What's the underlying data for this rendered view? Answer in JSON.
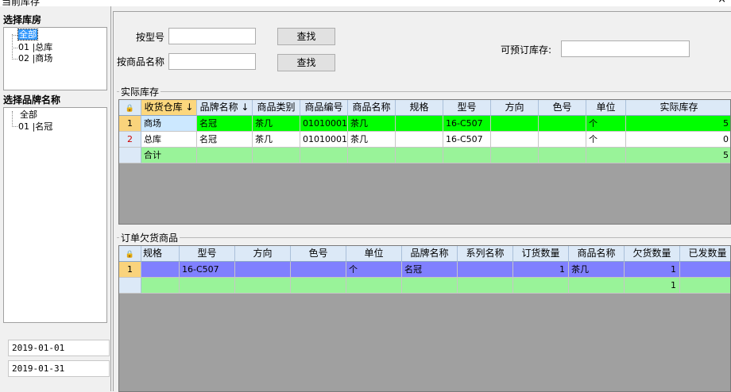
{
  "window": {
    "title": "当前库存",
    "close": "×"
  },
  "left": {
    "warehouse_title": "选择库房",
    "warehouses": [
      "全部",
      "01 |总库",
      "02 |商场"
    ],
    "brand_title": "选择品牌名称",
    "brands": [
      "全部",
      "01 |名冠"
    ],
    "date_from": "2019-01-01",
    "date_to": "2019-01-31"
  },
  "search": {
    "model_label": "按型号",
    "model_value": "",
    "name_label": "按商品名称",
    "name_value": "",
    "find_button_1": "查找",
    "find_button_2": "查找",
    "preorder_label": "可预订库存:",
    "preorder_value": ""
  },
  "stock": {
    "group_label": "实际库存",
    "columns": [
      "收货仓库 ↓",
      "品牌名称 ↓",
      "商品类别",
      "商品编号",
      "商品名称",
      "规格",
      "型号",
      "方向",
      "色号",
      "单位",
      "实际库存"
    ],
    "rows": [
      {
        "index": "1",
        "cells": [
          "商场",
          "名冠",
          "茶几",
          "01010001",
          "茶几",
          "",
          "16-C507",
          "",
          "",
          "个",
          "5"
        ]
      },
      {
        "index": "2",
        "cells": [
          "总库",
          "名冠",
          "茶几",
          "01010001",
          "茶几",
          "",
          "16-C507",
          "",
          "",
          "个",
          "0"
        ]
      }
    ],
    "total": [
      "合计",
      "",
      "",
      "",
      "",
      "",
      "",
      "",
      "",
      "",
      "5"
    ],
    "colors": {
      "row1": "#00ff00",
      "row2": "#ffffff",
      "total": "#99f399"
    }
  },
  "backorder": {
    "group_label": "订单欠货商品",
    "columns": [
      "规格",
      "型号",
      "方向",
      "色号",
      "单位",
      "品牌名称",
      "系列名称",
      "订货数量",
      "商品名称",
      "欠货数量",
      "已发数量"
    ],
    "rows": [
      {
        "index": "1",
        "cells": [
          "",
          "16-C507",
          "",
          "",
          "个",
          "名冠",
          "",
          "1",
          "茶几",
          "1",
          ""
        ]
      }
    ],
    "total": [
      "",
      "",
      "",
      "",
      "",
      "",
      "",
      "",
      "",
      "1",
      ""
    ],
    "colors": {
      "row1": "#8080ff",
      "total": "#99f399"
    }
  }
}
